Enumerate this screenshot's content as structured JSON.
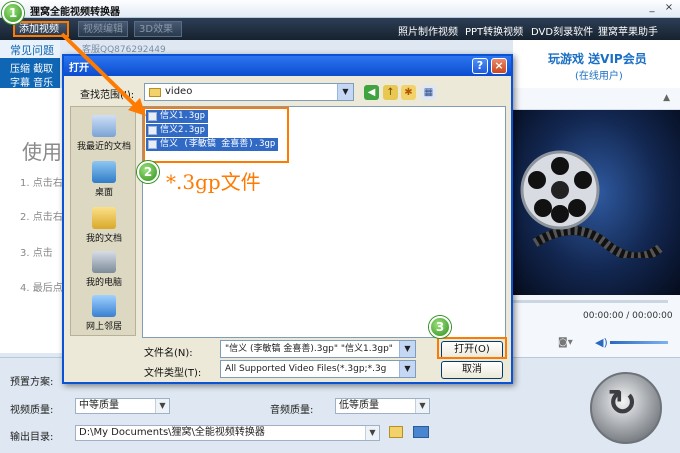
{
  "app": {
    "title": "狸窝全能视频转换器",
    "window_controls": {
      "minimize": "_",
      "close": "×"
    }
  },
  "toolbar": {
    "add_video": "添加视频",
    "video_edit": "视频编辑",
    "effect_3d": "3D效果",
    "links": [
      "照片制作视频",
      "PPT转换视频",
      "DVD刻录软件",
      "狸窝苹果助手"
    ]
  },
  "leftnav": {
    "tab_common": "常见问题",
    "line1": "压缩  截取",
    "line2": "字幕  音乐"
  },
  "support_qq": "客服QQ876292449",
  "content": {
    "heading": "使用",
    "steps": [
      "1. 点击右",
      "2. 点击右",
      "3. 点击",
      "4. 最后点"
    ]
  },
  "promo": {
    "line1": "玩游戏  送VIP会员",
    "line2": "(在线用户)"
  },
  "player": {
    "time": "00:00:00 / 00:00:00",
    "camera_icon": "camera-icon",
    "volume_icon": "speaker-icon"
  },
  "bottom": {
    "preset_label": "预置方案:",
    "video_quality_label": "视频质量:",
    "video_quality_value": "中等质量",
    "audio_quality_label": "音频质量:",
    "audio_quality_value": "低等质量",
    "output_label": "输出目录:",
    "output_value": "D:\\My Documents\\狸窝\\全能视频转换器"
  },
  "dialog": {
    "title": "打开",
    "help": "?",
    "close": "×",
    "look_in_label": "查找范围(I):",
    "look_in_value": "video",
    "places": [
      "我最近的文档",
      "桌面",
      "我的文档",
      "我的电脑",
      "网上邻居"
    ],
    "files": [
      "信义1.3gp",
      "信义2.3gp",
      "信义 (李敏镐 金喜善).3gp"
    ],
    "filename_label": "文件名(N):",
    "filename_value": "\"信义 (李敏镐 金喜善).3gp\" \"信义1.3gp\"",
    "filetype_label": "文件类型(T):",
    "filetype_value": "All Supported Video Files(*.3gp;*.3g",
    "open_button": "打开(O)",
    "cancel_button": "取消"
  },
  "annotations": {
    "step1": "1",
    "step2": "2",
    "step3": "3",
    "filetype_note": "*.3gp文件",
    "highlight_color": "#ff7a00"
  }
}
